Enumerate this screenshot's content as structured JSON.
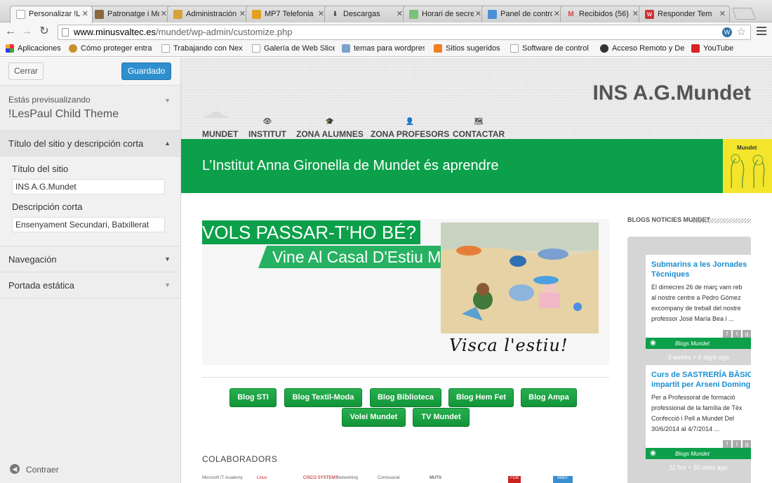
{
  "tabs": [
    {
      "label": "Personalizar !Le",
      "active": true
    },
    {
      "label": "Patronatge i Mo"
    },
    {
      "label": "Administración"
    },
    {
      "label": "MP7 Telefonia"
    },
    {
      "label": "Descargas"
    },
    {
      "label": "Horari de secre"
    },
    {
      "label": "Panel de contro"
    },
    {
      "label": "Recibidos (56)"
    },
    {
      "label": "Responder Tem"
    }
  ],
  "address": {
    "host": "www.minusvaltec.es",
    "path": "/mundet/wp-admin/customize.php"
  },
  "bookmarks": [
    "Aplicaciones",
    "Cómo proteger entra",
    "Trabajando con Nex",
    "Galería de Web Slice",
    "temas para wordpres",
    "Sitios sugeridos",
    "Software de control",
    "Acceso Remoto y De",
    "YouTube"
  ],
  "sidebar": {
    "close_label": "Cerrar",
    "save_label": "Guardado",
    "preview_label": "Estás previsualizando",
    "theme_name": "!LesPaul Child Theme",
    "section_title": "Título del sitio y descripción corta",
    "site_title_label": "Título del sitio",
    "site_title_value": "INS A.G.Mundet",
    "tagline_label": "Descripción corta",
    "tagline_value": "Ensenyament Secundari, Batxillerat",
    "nav_label": "Navegación",
    "static_label": "Portada estática",
    "collapse_label": "Contraer"
  },
  "site": {
    "title": "INS A.G.Mundet",
    "nav": [
      "MUNDET",
      "INSTITUT",
      "ZONA ALUMNES",
      "ZONA PROFESORS",
      "CONTACTAR"
    ],
    "tagline": "L’Institut Anna Gironella de Mundet és aprendre",
    "logo_text": "Mundet",
    "banner_line1": "VOLS PASSAR-T'HO BÉ?",
    "banner_line2": "Vine Al Casal D'Estiu Mu",
    "banner_caption": "Visca l'estiu!",
    "blog_buttons": [
      "Blog STI",
      "Blog Textil-Moda",
      "Blog Biblioteca",
      "Blog Hem Fet",
      "Blog Ampa",
      "Volei Mundet",
      "TV Mundet"
    ],
    "colaboradores": "COLABORADORS",
    "colab_logos": [
      "Microsoft IT Academy",
      "Linux",
      "CISCO SYSTEMS",
      "Networking",
      "Comissariat",
      "MUTS",
      "FCB",
      "ABEF"
    ],
    "side_title": "BLOGS NOTICIES MUNDET",
    "cards": [
      {
        "title1": "Submarins a les Jornades",
        "title2": "Tècniques",
        "text1": "El dimecres 26 de març vam reb",
        "text2": "al nostre centre a Pedro Gómez",
        "text3": "excompany de treball del nostre",
        "text4": "professor José María Bea i ...",
        "footer": "Blogs Mundet",
        "meta": "3 weeks + 6 days ago"
      },
      {
        "title1": "Curs de SASTRERÍA BÀSIC",
        "title2": "impartit per Arseni Doming",
        "text1": "Per a Professorat de formació",
        "text2": "professional de la família de Tèx",
        "text3": "Confecció i Pell a Mundet Del",
        "text4": "30/6/2014 al 4/7/2014 ...",
        "footer": "Blogs Mundet",
        "meta": "11 hrs + 50 mins ago"
      }
    ]
  },
  "colors": {
    "accent_green": "#0ca04a",
    "wp_blue": "#2e8fcf",
    "logo_yellow": "#f4e52b"
  }
}
